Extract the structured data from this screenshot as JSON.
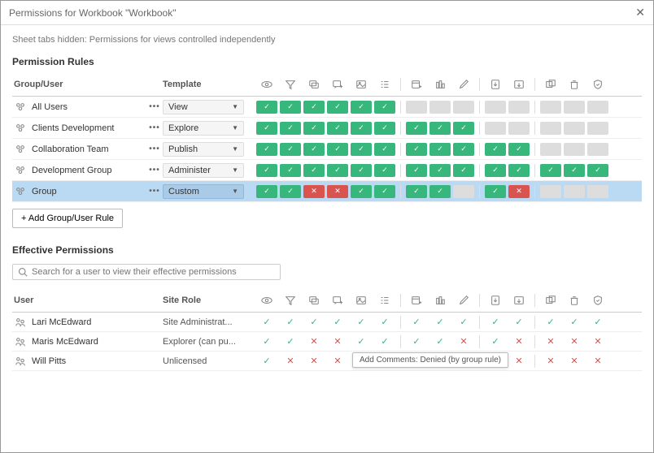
{
  "window": {
    "title": "Permissions for Workbook \"Workbook\"",
    "subtitle": "Sheet tabs hidden: Permissions for views controlled independently"
  },
  "rules": {
    "section_title": "Permission Rules",
    "col_group": "Group/User",
    "col_template": "Template",
    "add_button": "Add Group/User Rule",
    "rows": [
      {
        "name": "All Users",
        "template": "View",
        "perms": [
          "allow",
          "allow",
          "allow",
          "allow",
          "allow",
          "allow",
          "sep",
          "unset",
          "unset",
          "unset",
          "sep",
          "unset",
          "unset",
          "sep",
          "unset",
          "unset",
          "unset"
        ],
        "selected": false
      },
      {
        "name": "Clients Development",
        "template": "Explore",
        "perms": [
          "allow",
          "allow",
          "allow",
          "allow",
          "allow",
          "allow",
          "sep",
          "allow",
          "allow",
          "allow",
          "sep",
          "unset",
          "unset",
          "sep",
          "unset",
          "unset",
          "unset"
        ],
        "selected": false
      },
      {
        "name": "Collaboration Team",
        "template": "Publish",
        "perms": [
          "allow",
          "allow",
          "allow",
          "allow",
          "allow",
          "allow",
          "sep",
          "allow",
          "allow",
          "allow",
          "sep",
          "allow",
          "allow",
          "sep",
          "unset",
          "unset",
          "unset"
        ],
        "selected": false
      },
      {
        "name": "Development Group",
        "template": "Administer",
        "perms": [
          "allow",
          "allow",
          "allow",
          "allow",
          "allow",
          "allow",
          "sep",
          "allow",
          "allow",
          "allow",
          "sep",
          "allow",
          "allow",
          "sep",
          "allow",
          "allow",
          "allow"
        ],
        "selected": false
      },
      {
        "name": "Group",
        "template": "Custom",
        "perms": [
          "allow",
          "allow",
          "deny",
          "deny",
          "allow",
          "allow",
          "sep",
          "allow",
          "allow",
          "unset",
          "sep",
          "allow",
          "deny",
          "sep",
          "unset",
          "unset",
          "unset"
        ],
        "selected": true
      }
    ]
  },
  "effective": {
    "section_title": "Effective Permissions",
    "search_placeholder": "Search for a user to view their effective permissions",
    "col_user": "User",
    "col_role": "Site Role",
    "rows": [
      {
        "name": "Lari McEdward",
        "role": "Site Administrat...",
        "perms": [
          "allow",
          "allow",
          "allow",
          "allow",
          "allow",
          "allow",
          "sep",
          "allow",
          "allow",
          "allow",
          "sep",
          "allow",
          "allow",
          "sep",
          "allow",
          "allow",
          "allow"
        ]
      },
      {
        "name": "Maris McEdward",
        "role": "Explorer (can pu...",
        "perms": [
          "allow",
          "allow",
          "deny",
          "deny",
          "allow",
          "allow",
          "sep",
          "allow",
          "allow",
          "deny",
          "sep",
          "allow",
          "deny",
          "sep",
          "deny",
          "deny",
          "deny"
        ]
      },
      {
        "name": "Will Pitts",
        "role": "Unlicensed",
        "perms": [
          "allow",
          "deny",
          "deny",
          "deny",
          "tooltip",
          "",
          "sep",
          "",
          "",
          "",
          "sep",
          "allow",
          "deny",
          "sep",
          "deny",
          "deny",
          "deny"
        ]
      }
    ]
  },
  "tooltip": {
    "text": "Add Comments: Denied (by group rule)"
  },
  "perm_headers": [
    "view",
    "filter",
    "comment",
    "addcomment",
    "image",
    "summary",
    "sep",
    "web",
    "share",
    "edit",
    "sep",
    "download",
    "saveas",
    "sep",
    "move",
    "delete",
    "perms"
  ]
}
